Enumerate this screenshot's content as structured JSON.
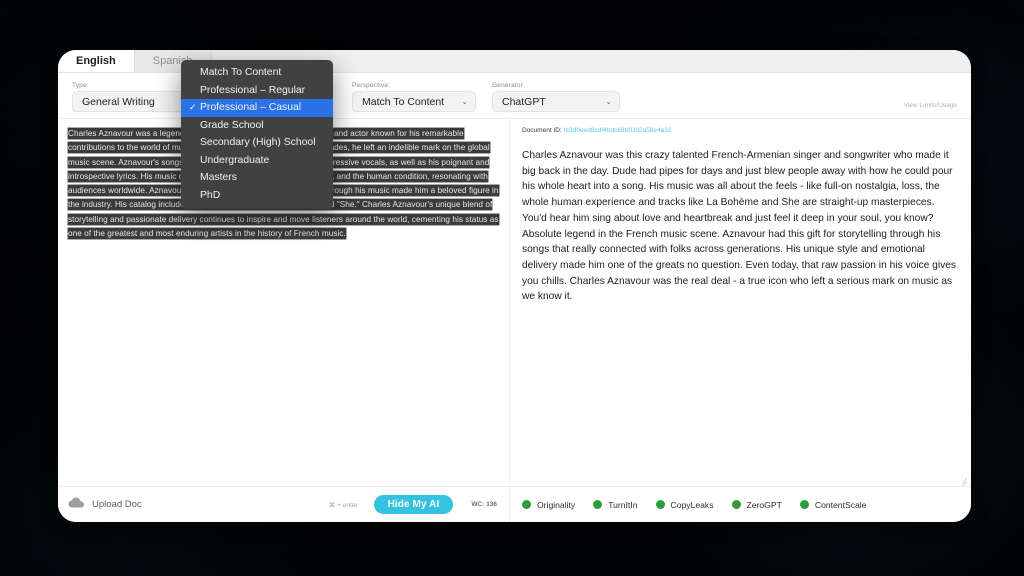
{
  "app": {
    "tabs": [
      {
        "label": "English",
        "active": true
      },
      {
        "label": "Spanish",
        "active": false
      }
    ]
  },
  "toolbar": {
    "type_label": "Type:",
    "type_value": "General Writing",
    "perspective_label": "Perspective:",
    "perspective_value": "Match To Content",
    "generator_label": "Generator:",
    "generator_value": "ChatGPT",
    "limits_link": "View Limits/Usage",
    "chevron": "⌄"
  },
  "type_dropdown": {
    "open": true,
    "check_glyph": "✓",
    "items": [
      {
        "label": "Match To Content",
        "selected": false
      },
      {
        "label": "Professional – Regular",
        "selected": false
      },
      {
        "label": "Professional – Casual",
        "selected": true
      },
      {
        "label": "Grade School",
        "selected": false
      },
      {
        "label": "Secondary (High) School",
        "selected": false
      },
      {
        "label": "Undergraduate",
        "selected": false
      },
      {
        "label": "Masters",
        "selected": false
      },
      {
        "label": "PhD",
        "selected": false
      }
    ]
  },
  "editor": {
    "source_text": "Charles Aznavour was a legendary French-Armenian singer, songwriter, and actor known for his remarkable contributions to the world of music. Over a career spanning several decades, he left an indelible mark on the global music scene. Aznavour's songs were celebrated for his emotive and expressive vocals, as well as his poignant and introspective lyrics. His music often explored themes of love, heartbreak, and the human condition, resonating with audiences worldwide. Aznavour's ability to convey profound emotions through his music made him a beloved figure in the industry. His catalog includes timeless classics like \"La Bohème\" and \"She.\" Charles Aznavour's unique blend of storytelling and passionate delivery continues to inspire and move listeners around the world, cementing his status as one of the greatest and most enduring artists in the history of French music."
  },
  "output": {
    "doc_id_label": "Document ID:",
    "doc_id_value": "fe3d0eed8cdf4bdc69bf1fd2a56e4a32",
    "text": "Charles Aznavour was this crazy talented French-Armenian singer and songwriter who made it big back in the day.  Dude had pipes for days and just blew people away with how he could pour his whole heart into a song.  His music was all about the feels - like full-on nostalgia, loss, the whole human experience and  tracks like La Bohème and She are straight-up masterpieces.  You'd hear him sing about love and heartbreak and just feel it deep in your soul, you know? Absolute legend in the French music scene.  Aznavour had this gift for storytelling through his songs that really connected with folks across generations.  His unique style and emotional delivery made him one of the greats no question.  Even today, that raw passion in his voice gives you chills.  Charles Aznavour was the real deal - a true icon who left a serious mark on music as we know it."
  },
  "bottom": {
    "upload_label": "Upload Doc",
    "kbd_hint": "⌘ + enter",
    "hide_button": "Hide My AI",
    "word_count": "WC: 136",
    "detectors": [
      {
        "label": "Originality",
        "color": "#2e9b3f"
      },
      {
        "label": "TurnItIn",
        "color": "#2e9b3f"
      },
      {
        "label": "CopyLeaks",
        "color": "#2e9b3f"
      },
      {
        "label": "ZeroGPT",
        "color": "#2e9b3f"
      },
      {
        "label": "ContentScale",
        "color": "#2e9b3f"
      }
    ]
  },
  "colors": {
    "accent": "#35c2e0",
    "dropdown_highlight": "#2a72e6",
    "doc_id": "#5bc8e8",
    "detector_green": "#2e9b3f"
  }
}
